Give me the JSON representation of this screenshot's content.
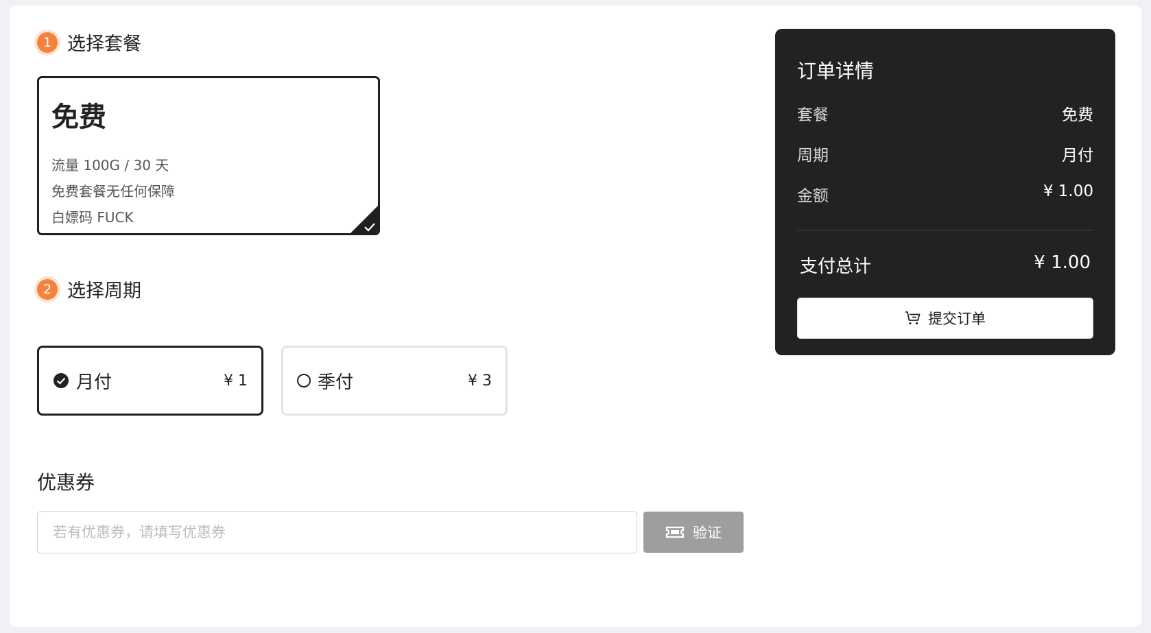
{
  "steps": {
    "plan": {
      "number": "1",
      "title": "选择套餐"
    },
    "period": {
      "number": "2",
      "title": "选择周期"
    }
  },
  "plan": {
    "name": "免费",
    "lines": [
      "流量 100G / 30 天",
      "免费套餐无任何保障",
      "白嫖码 FUCK"
    ],
    "selected": true
  },
  "periods": [
    {
      "label": "月付",
      "price": "¥ 1",
      "selected": true
    },
    {
      "label": "季付",
      "price": "¥ 3",
      "selected": false
    }
  ],
  "coupon": {
    "title": "优惠券",
    "placeholder": "若有优惠券，请填写优惠券",
    "value": "",
    "verify_label": "验证"
  },
  "order": {
    "title": "订单详情",
    "rows": [
      {
        "key": "套餐",
        "value": "免费"
      },
      {
        "key": "周期",
        "value": "月付"
      },
      {
        "key": "金额",
        "value": "¥ 1.00"
      }
    ],
    "total_label": "支付总计",
    "total_value": "¥ 1.00",
    "submit_label": "提交订单"
  },
  "colors": {
    "accent": "#f3823c",
    "dark_panel": "#222222",
    "verify_button": "#9e9e9e"
  }
}
